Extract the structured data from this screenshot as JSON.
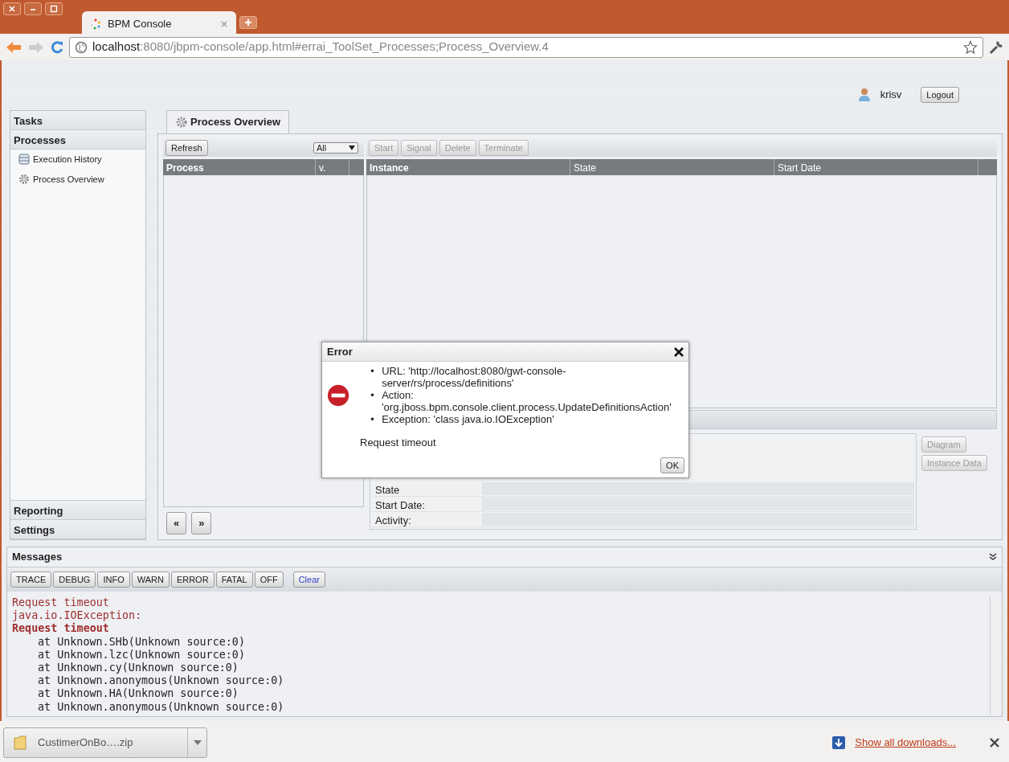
{
  "browser": {
    "tab_title": "BPM Console",
    "url_host": "localhost",
    "url_path": ":8080/jbpm-console/app.html#errai_ToolSet_Processes;Process_Overview.4"
  },
  "user": {
    "name": "krisv",
    "logout": "Logout"
  },
  "sidebar": [
    {
      "label": "Tasks"
    },
    {
      "label": "Processes",
      "items": [
        {
          "label": "Execution History",
          "kind": "table"
        },
        {
          "label": "Process Overview",
          "kind": "gear"
        }
      ]
    },
    {
      "label": "Reporting"
    },
    {
      "label": "Settings"
    }
  ],
  "main_tab": {
    "label": "Process Overview"
  },
  "process_list": {
    "refresh": "Refresh",
    "filter": "All",
    "columns": [
      "Process",
      "v."
    ]
  },
  "pager": [
    "«",
    "»"
  ],
  "instance_list": {
    "buttons": [
      {
        "label": "Start",
        "disabled": true
      },
      {
        "label": "Signal",
        "disabled": true
      },
      {
        "label": "Delete",
        "disabled": true
      },
      {
        "label": "Terminate",
        "disabled": true
      }
    ],
    "columns": [
      "Instance",
      "State",
      "Start Date"
    ]
  },
  "details": {
    "rows": [
      "State",
      "Start Date:",
      "Activity:"
    ],
    "buttons": [
      {
        "label": "Diagram",
        "disabled": true
      },
      {
        "label": "Instance Data",
        "disabled": true
      }
    ]
  },
  "dialog": {
    "title": "Error",
    "bullet": "•",
    "items": [
      "URL: 'http://localhost:8080/gwt-console-server/rs/process/definitions'",
      "Action: 'org.jboss.bpm.console.client.process.UpdateDefinitionsAction'",
      "Exception: 'class java.io.IOException'"
    ],
    "message": "Request timeout",
    "ok": "OK"
  },
  "messages": {
    "title": "Messages",
    "levels": [
      "TRACE",
      "DEBUG",
      "INFO",
      "WARN",
      "ERROR",
      "FATAL",
      "OFF"
    ],
    "clear": "Clear",
    "log": [
      {
        "text": "Request timeout",
        "kind": "error"
      },
      {
        "text": "java.io.IOException:",
        "kind": "error"
      },
      {
        "text": "Request timeout",
        "kind": "error_bold"
      },
      {
        "text": "at Unknown.SHb(Unknown source:0)",
        "kind": "frame"
      },
      {
        "text": "at Unknown.lzc(Unknown source:0)",
        "kind": "frame"
      },
      {
        "text": "at Unknown.cy(Unknown source:0)",
        "kind": "frame"
      },
      {
        "text": "at Unknown.anonymous(Unknown source:0)",
        "kind": "frame"
      },
      {
        "text": "at Unknown.HA(Unknown source:0)",
        "kind": "frame"
      },
      {
        "text": "at Unknown.anonymous(Unknown source:0)",
        "kind": "frame"
      }
    ]
  },
  "downloads": {
    "file": "CustimerOnBo….zip",
    "show_all": "Show all downloads..."
  }
}
